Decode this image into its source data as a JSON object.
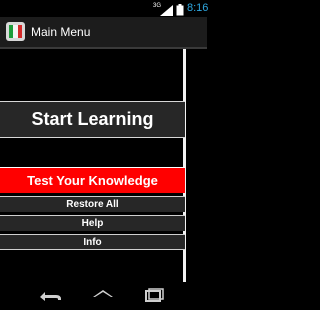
{
  "status_bar": {
    "network": "3G",
    "time": "8:16",
    "signal_icon": "signal-icon",
    "battery_icon": "battery-icon"
  },
  "action_bar": {
    "app_icon": "italy-flag-icon",
    "title": "Main Menu"
  },
  "menu": {
    "start_learning": "Start Learning",
    "test_knowledge": "Test Your Knowledge",
    "restore_all": "Restore All",
    "help": "Help",
    "info": "Info"
  },
  "nav_bar": {
    "back_icon": "back-icon",
    "home_icon": "home-icon",
    "recent_icon": "recent-apps-icon"
  },
  "colors": {
    "accent_test": "#ff0000",
    "button_bg": "#272727",
    "clock": "#2ea7e0"
  }
}
